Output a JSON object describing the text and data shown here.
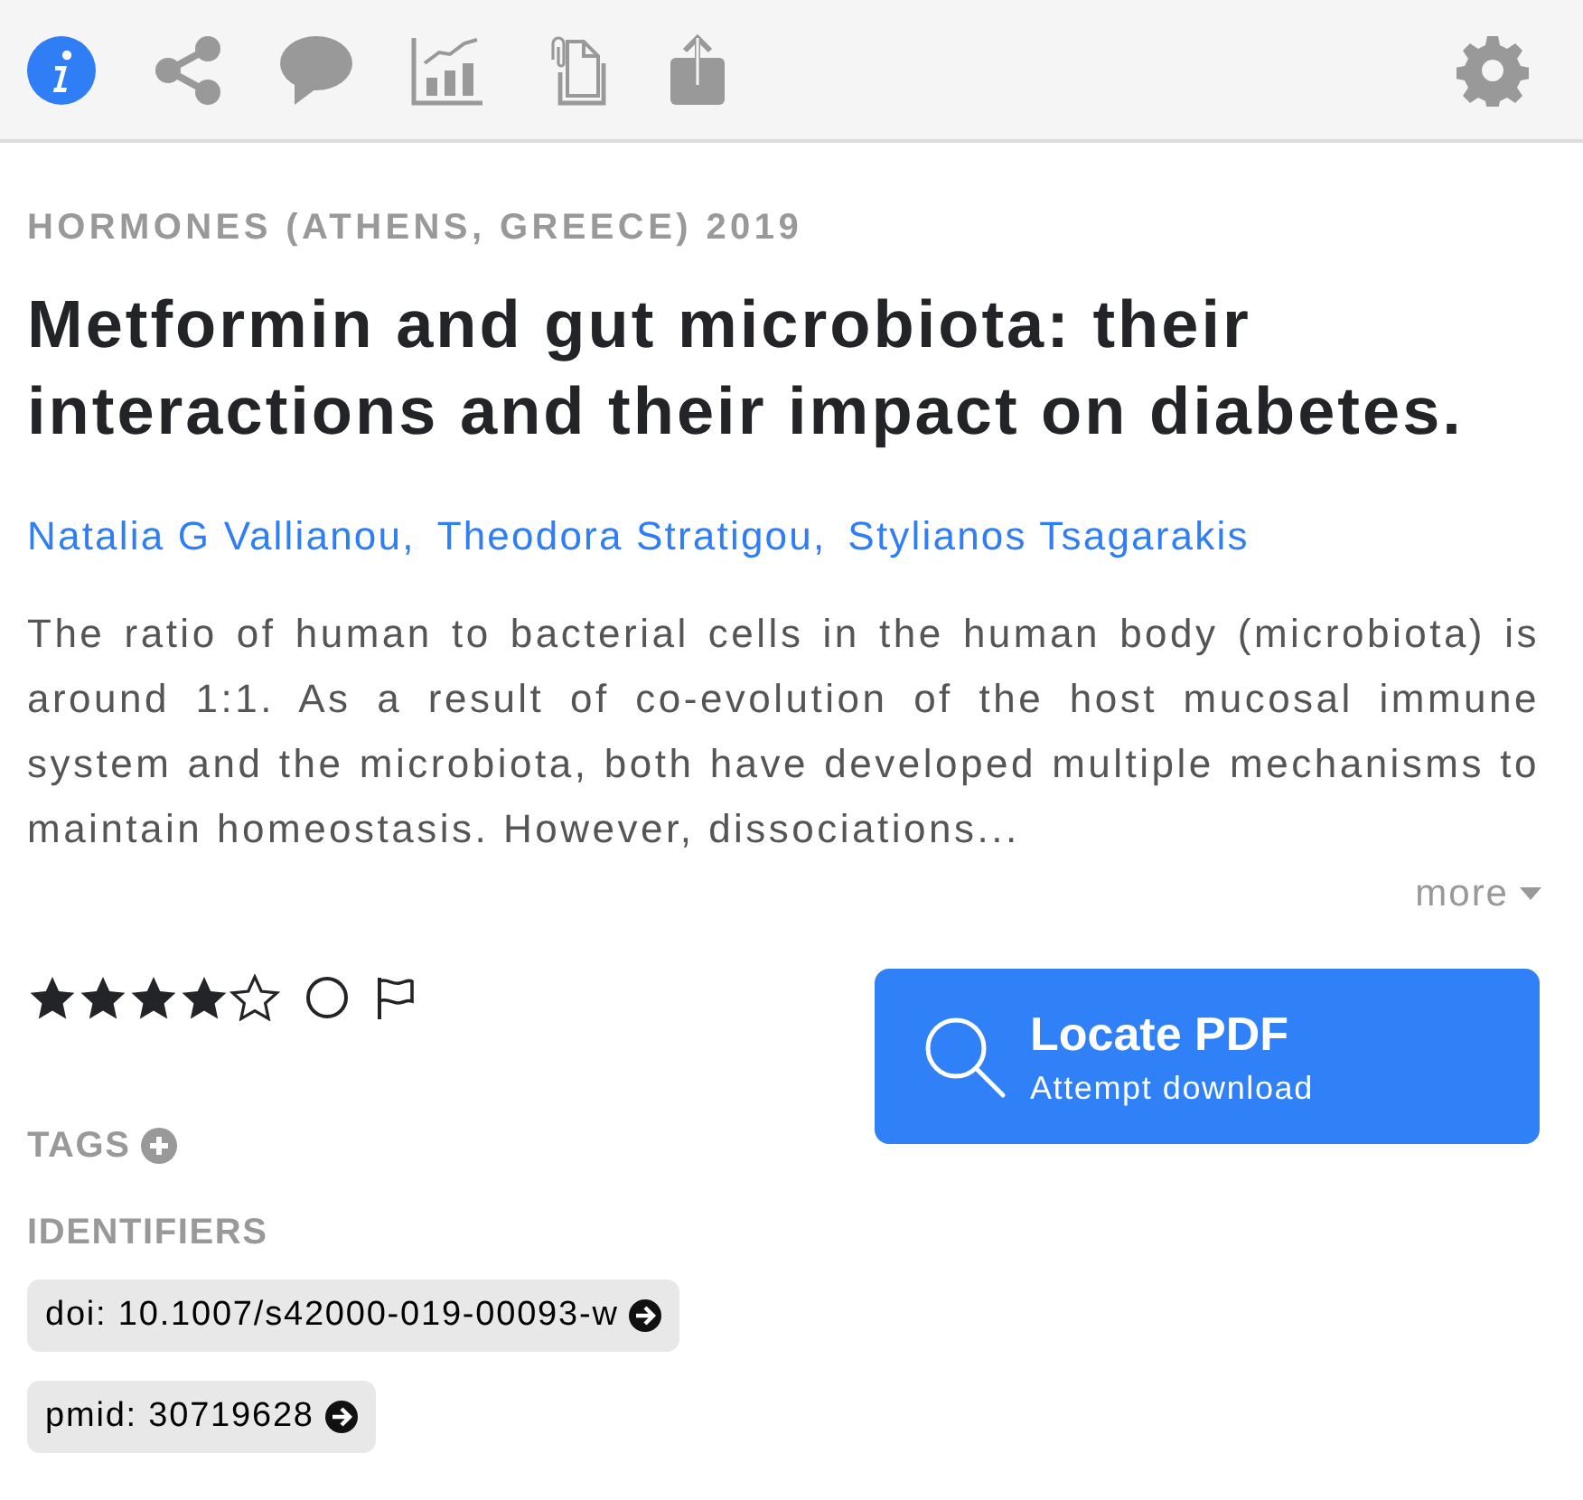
{
  "toolbar": {
    "tabs": [
      {
        "kind": "info",
        "selected": true
      },
      {
        "kind": "share",
        "selected": false
      },
      {
        "kind": "comments",
        "selected": false
      },
      {
        "kind": "chart",
        "selected": false
      },
      {
        "kind": "attachments",
        "selected": false
      },
      {
        "kind": "export",
        "selected": false
      }
    ]
  },
  "article": {
    "journal": "HORMONES (ATHENS, GREECE) 2019",
    "title": "Metformin and gut microbiota: their interactions and their impact on diabetes.",
    "authors": [
      "Natalia G Vallianou,",
      "Theodora Stratigou,",
      "Stylianos Tsagarakis"
    ],
    "abstract": "The ratio of human to bacterial cells in the human body (microbiota) is around 1:1. As a result of co-evolution of the host mucosal immune system and the microbiota, both have developed multiple mechanisms to maintain homeostasis. However, dissociations...",
    "more_link": "more"
  },
  "rating": {
    "stars": 4,
    "read": false,
    "flagged": false
  },
  "pdf_button": {
    "label": "Locate PDF",
    "sublabel": "Attempt download"
  },
  "tags": {
    "heading": "TAGS"
  },
  "identifiers": {
    "heading": "IDENTIFIERS",
    "items": [
      "doi: 10.1007/s42000-019-00093-w",
      "pmid: 30719628"
    ]
  }
}
